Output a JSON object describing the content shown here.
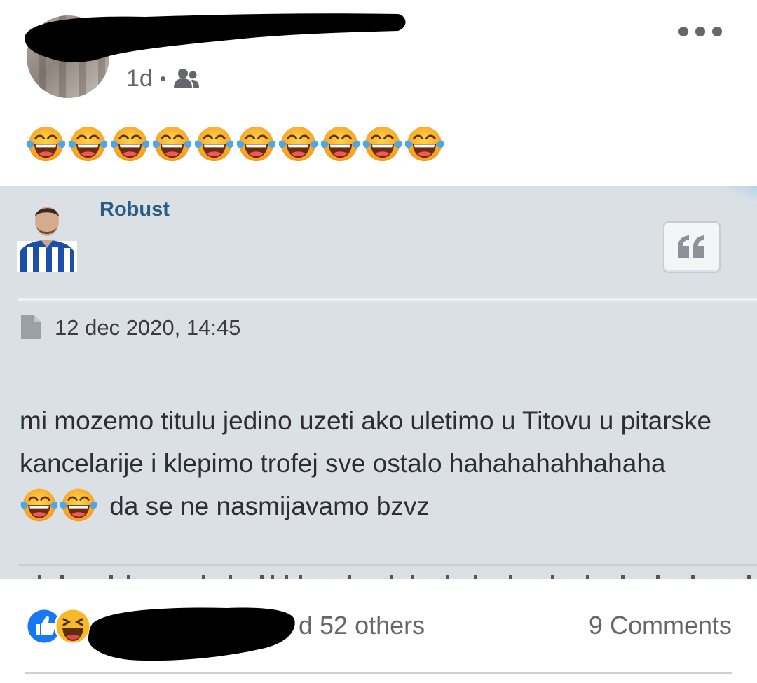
{
  "post": {
    "time": "1d",
    "separator": "•",
    "audience_icon": "friends-icon",
    "more_icon": "more-options-icon",
    "emoji_name": "face-with-tears-of-joy",
    "emoji_count": 10
  },
  "screenshot": {
    "username": "Robust",
    "quote_icon": "quote-icon",
    "file_icon": "document-icon",
    "date": "12 dec 2020, 14:45",
    "text_before_emoji": "mi mozemo titulu jedino uzeti ako uletimo u Titovu u pitarske kancelarije i klepimo trofej sve ostalo hahahahahhahaha ",
    "text_after_emoji": " da se ne nasmijavamo bzvz",
    "colors": {
      "background": "#dbe0e5",
      "username": "#2a5d84"
    }
  },
  "footer": {
    "reaction_icons": [
      "like-icon",
      "haha-icon"
    ],
    "others_text": "d 52 others",
    "comments_text": "9 Comments"
  }
}
